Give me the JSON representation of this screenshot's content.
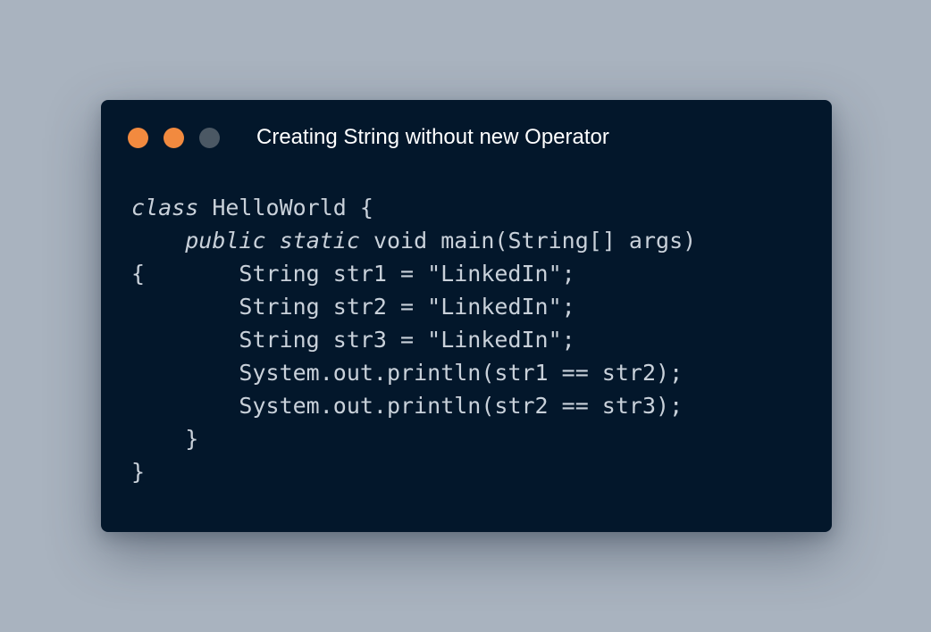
{
  "window": {
    "title": "Creating String without new Operator",
    "dots": [
      {
        "name": "window-dot-1",
        "color": "#f28a3f"
      },
      {
        "name": "window-dot-2",
        "color": "#f28a3f"
      },
      {
        "name": "window-dot-3",
        "color": "#4b5864"
      }
    ]
  },
  "code": {
    "language": "java",
    "lines": [
      {
        "indent": "",
        "tokens": [
          {
            "text": "class",
            "italic": true
          },
          {
            "text": " HelloWorld {",
            "italic": false
          }
        ]
      },
      {
        "indent": "    ",
        "tokens": [
          {
            "text": "public",
            "italic": true
          },
          {
            "text": " ",
            "italic": false
          },
          {
            "text": "static",
            "italic": true
          },
          {
            "text": " void main(String[] args)",
            "italic": false
          }
        ]
      },
      {
        "indent": "",
        "tokens": [
          {
            "text": "{       String str1 = \"LinkedIn\";",
            "italic": false
          }
        ]
      },
      {
        "indent": "        ",
        "tokens": [
          {
            "text": "String str2 = \"LinkedIn\";",
            "italic": false
          }
        ]
      },
      {
        "indent": "        ",
        "tokens": [
          {
            "text": "String str3 = \"LinkedIn\";",
            "italic": false
          }
        ]
      },
      {
        "indent": "        ",
        "tokens": [
          {
            "text": "System.out.println(str1 == str2);",
            "italic": false
          }
        ]
      },
      {
        "indent": "        ",
        "tokens": [
          {
            "text": "System.out.println(str2 == str3);",
            "italic": false
          }
        ]
      },
      {
        "indent": "    ",
        "tokens": [
          {
            "text": "}",
            "italic": false
          }
        ]
      },
      {
        "indent": "",
        "tokens": [
          {
            "text": "}",
            "italic": false
          }
        ]
      }
    ]
  },
  "colors": {
    "background": "#a9b3bf",
    "window": "#03172b",
    "title_text": "#ffffff",
    "code_text": "#c9d1da"
  }
}
